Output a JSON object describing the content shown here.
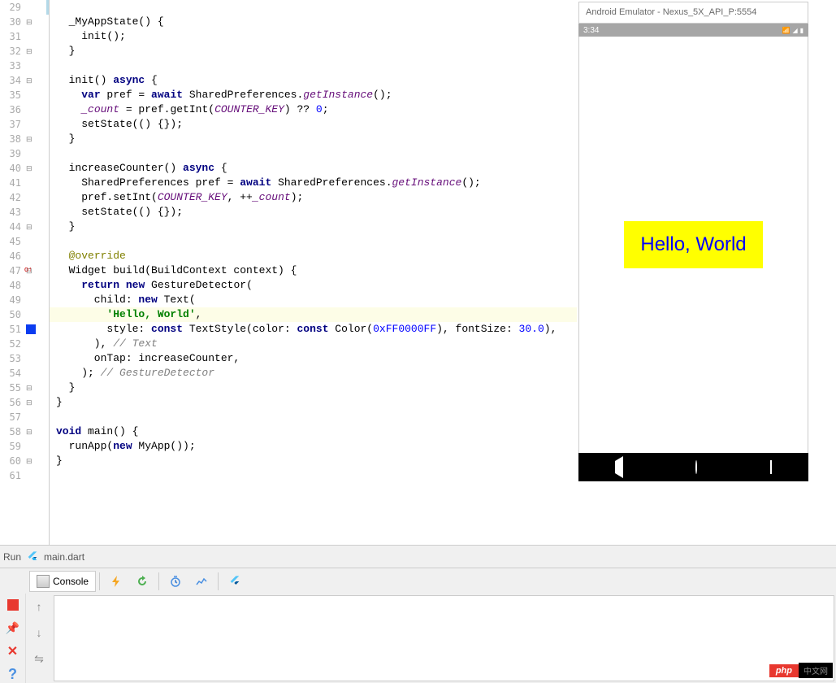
{
  "editor": {
    "lines": [
      {
        "n": 29,
        "text": ""
      },
      {
        "n": 30,
        "text": "_MyAppState() {",
        "fold": true
      },
      {
        "n": 31,
        "text": "  init();"
      },
      {
        "n": 32,
        "text": "}",
        "unfold": true
      },
      {
        "n": 33,
        "text": ""
      },
      {
        "n": 34,
        "text": "init() async {",
        "fold": true
      },
      {
        "n": 35,
        "text": "  var pref = await SharedPreferences.getInstance();"
      },
      {
        "n": 36,
        "text": "  _count = pref.getInt(COUNTER_KEY) ?? 0;"
      },
      {
        "n": 37,
        "text": "  setState(() {});"
      },
      {
        "n": 38,
        "text": "}",
        "unfold": true
      },
      {
        "n": 39,
        "text": ""
      },
      {
        "n": 40,
        "text": "increaseCounter() async {",
        "fold": true
      },
      {
        "n": 41,
        "text": "  SharedPreferences pref = await SharedPreferences.getInstance();"
      },
      {
        "n": 42,
        "text": "  pref.setInt(COUNTER_KEY, ++_count);"
      },
      {
        "n": 43,
        "text": "  setState(() {});"
      },
      {
        "n": 44,
        "text": "}",
        "unfold": true
      },
      {
        "n": 45,
        "text": ""
      },
      {
        "n": 46,
        "text": "@override"
      },
      {
        "n": 47,
        "text": "Widget build(BuildContext context) {",
        "fold": true,
        "marker": "ov"
      },
      {
        "n": 48,
        "text": "  return new GestureDetector("
      },
      {
        "n": 49,
        "text": "    child: new Text("
      },
      {
        "n": 50,
        "text": "      'Hello, World',",
        "hl": true
      },
      {
        "n": 51,
        "text": "      style: const TextStyle(color: const Color(0xFF0000FF), fontSize: 30.0),",
        "blue": true
      },
      {
        "n": 52,
        "text": "    ), // Text"
      },
      {
        "n": 53,
        "text": "    onTap: increaseCounter,"
      },
      {
        "n": 54,
        "text": "  ); // GestureDetector"
      },
      {
        "n": 55,
        "text": "}",
        "unfold": true
      },
      {
        "n": 56,
        "text": "}",
        "unfold": true
      },
      {
        "n": 57,
        "text": ""
      },
      {
        "n": 58,
        "text": "void main() {",
        "fold": true
      },
      {
        "n": 59,
        "text": "  runApp(new MyApp());"
      },
      {
        "n": 60,
        "text": "}",
        "unfold": true
      },
      {
        "n": 61,
        "text": ""
      }
    ],
    "code_html": {
      "30": "  _MyAppState() {",
      "31": "    init();",
      "32": "  }",
      "34": "  init() <span class='kw'>async</span> {",
      "35": "    <span class='kw'>var</span> pref = <span class='kw'>await</span> SharedPreferences.<span class='ital'>getInstance</span>();",
      "36": "    <span class='ital'>_count</span> = pref.getInt(<span class='ital'>COUNTER_KEY</span>) ?? <span class='num'>0</span>;",
      "37": "    setState(() {});",
      "38": "  }",
      "40": "  increaseCounter() <span class='kw'>async</span> {",
      "41": "    SharedPreferences pref = <span class='kw'>await</span> SharedPreferences.<span class='ital'>getInstance</span>();",
      "42": "    pref.setInt(<span class='ital'>COUNTER_KEY</span>, ++<span class='ital'>_count</span>);",
      "43": "    setState(() {});",
      "44": "  }",
      "46": "  <span class='ann'>@override</span>",
      "47": "  Widget build(BuildContext context) {",
      "48": "    <span class='kw'>return</span> <span class='kw'>new</span> GestureDetector(",
      "49": "      child: <span class='kw'>new</span> Text(",
      "50": "        <span class='str'>'Hello, World'</span>,",
      "51": "        style: <span class='kw'>const</span> TextStyle(color: <span class='kw'>const</span> Color(<span class='hex'>0xFF0000FF</span>), fontSize: <span class='num'>30.0</span>),",
      "52": "      ), <span class='comment'>// Text</span>",
      "53": "      onTap: increaseCounter,",
      "54": "    ); <span class='comment'>// GestureDetector</span>",
      "55": "  }",
      "56": "}",
      "58": "<span class='kw'>void</span> main() {",
      "59": "  runApp(<span class='kw'>new</span> MyApp());",
      "60": "}"
    }
  },
  "emulator": {
    "title": "Android Emulator - Nexus_5X_API_P:5554",
    "time": "3:34",
    "hello": "Hello, World"
  },
  "run_tab": {
    "label": "Run",
    "file": "main.dart"
  },
  "console": {
    "label": "Console"
  },
  "badge": {
    "left": "php",
    "right": "中文网"
  }
}
